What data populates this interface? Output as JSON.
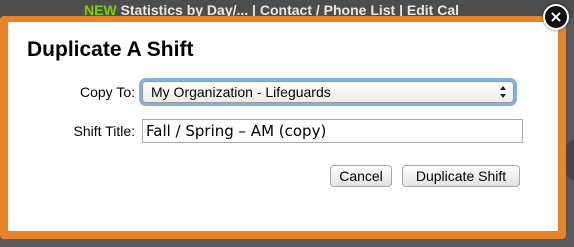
{
  "background": {
    "banner_badge": "NEW",
    "banner_text": " Statistics by Day/... | Contact / Phone List | Edit Cal"
  },
  "dialog": {
    "title": "Duplicate A Shift",
    "close_glyph": "×",
    "copy_to": {
      "label": "Copy To:",
      "selected": "My Organization - Lifeguards"
    },
    "shift_title": {
      "label": "Shift Title:",
      "value": "Fall / Spring – AM (copy)"
    },
    "buttons": {
      "cancel": "Cancel",
      "duplicate": "Duplicate Shift"
    }
  },
  "colors": {
    "modal_border": "#e8832a",
    "focus_ring": "#7fb1e6"
  }
}
